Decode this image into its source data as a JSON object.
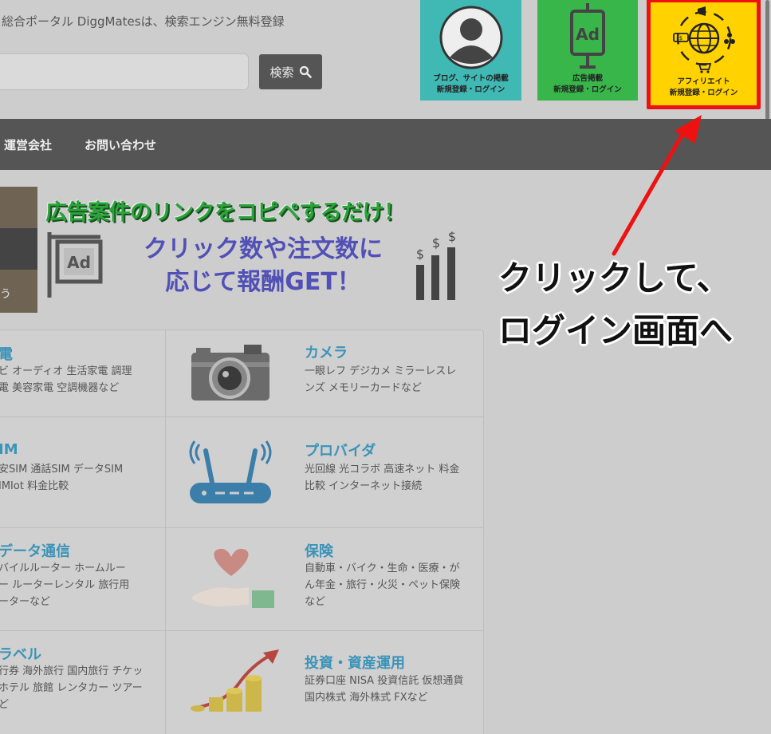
{
  "header": {
    "tagline": "総合ポータル DiggMatesは、検索エンジン無料登録",
    "search_label": "検索"
  },
  "registration": {
    "blog": {
      "line1": "ブログ、サイトの掲載",
      "line2": "新規登録・ログイン",
      "color": "#40b8b4"
    },
    "ad": {
      "line1": "広告掲載",
      "line2": "新規登録・ログイン",
      "color": "#38b64a"
    },
    "affiliate": {
      "line1": "アフィリエイト",
      "line2": "新規登録・ログイン",
      "color": "#ffd200",
      "highlight": "#ee1111"
    }
  },
  "nav": {
    "items": [
      "運営会社",
      "お問い合わせ"
    ]
  },
  "slider": {
    "fragment": "う"
  },
  "banner": {
    "headline": "広告案件のリンクをコピペするだけ！",
    "line1": "クリック数や注文数に",
    "line2": "応じて報酬GET！"
  },
  "categories": {
    "left": [
      {
        "title": "電",
        "desc": [
          "ビ オーディオ 生活家電 調理",
          "電 美容家電 空調機器など"
        ]
      },
      {
        "title": "IM",
        "desc": [
          "安SIM 通話SIM データSIM",
          "IMIot 料金比較"
        ]
      },
      {
        "title": "データ通信",
        "desc": [
          "バイルルーター ホームルー",
          "ー ルーターレンタル 旅行用",
          "ーターなど"
        ]
      },
      {
        "title": "ラベル",
        "desc": [
          "行券 海外旅行 国内旅行 チケッ",
          "ホテル 旅館 レンタカー ツアー",
          "ど"
        ]
      }
    ],
    "right": [
      {
        "title": "カメラ",
        "desc": [
          "一眼レフ デジカメ ミラーレスレ",
          "ンズ メモリーカードなど"
        ],
        "icon": "camera-icon"
      },
      {
        "title": "プロバイダ",
        "desc": [
          "光回線 光コラボ 高速ネット 料金",
          "比較 インターネット接続"
        ],
        "icon": "router-icon"
      },
      {
        "title": "保険",
        "desc": [
          "自動車・バイク・生命・医療・が",
          "ん年金・旅行・火災・ペット保険",
          "など"
        ],
        "icon": "heart-hand-icon"
      },
      {
        "title": "投資・資産運用",
        "desc": [
          "証券口座 NISA 投資信託 仮想通貨",
          "国内株式 海外株式 FXなど"
        ],
        "icon": "coins-growth-icon"
      }
    ]
  },
  "annotation": {
    "line1": "クリックして、",
    "line2": "ログイン画面へ",
    "arrow_color": "#ee1111"
  }
}
